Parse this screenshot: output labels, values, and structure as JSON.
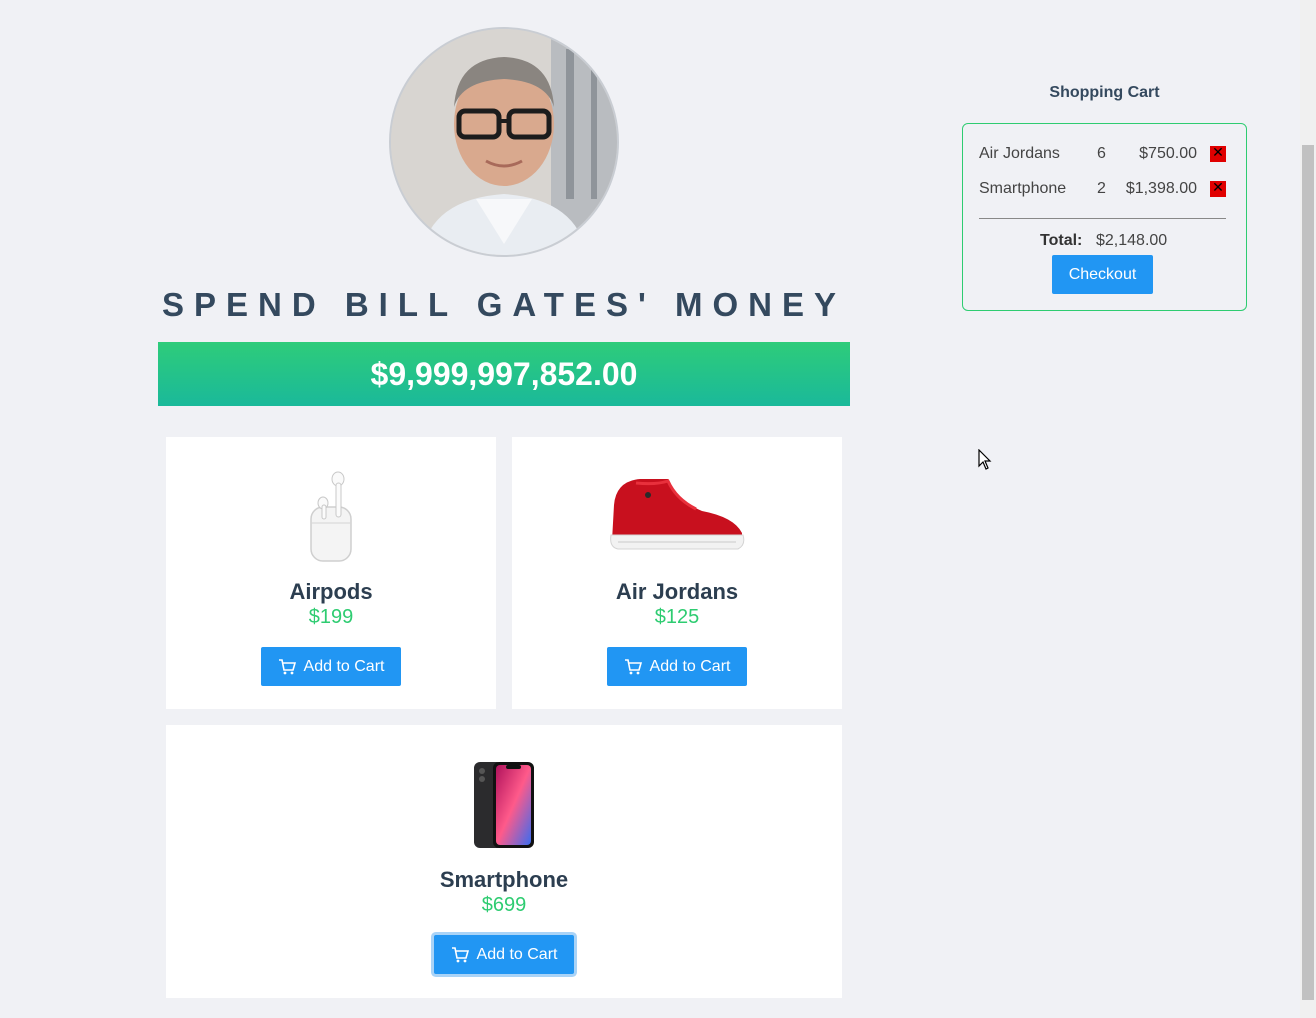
{
  "header": {
    "title": "SPEND BILL GATES' MONEY",
    "balance": "$9,999,997,852.00"
  },
  "products": [
    {
      "name": "Airpods",
      "price": "$199",
      "button": "Add to Cart"
    },
    {
      "name": "Air Jordans",
      "price": "$125",
      "button": "Add to Cart"
    },
    {
      "name": "Smartphone",
      "price": "$699",
      "button": "Add to Cart"
    }
  ],
  "cart": {
    "title": "Shopping Cart",
    "items": [
      {
        "name": "Air Jordans",
        "qty": "6",
        "total": "$750.00"
      },
      {
        "name": "Smartphone",
        "qty": "2",
        "total": "$1,398.00"
      }
    ],
    "total_label": "Total:",
    "total_value": "$2,148.00",
    "checkout_label": "Checkout"
  },
  "colors": {
    "accent": "#2196f3",
    "price": "#2ecc71",
    "balance_bg": "#2ecc7a",
    "remove": "#e00000"
  },
  "icons": [
    "cart-icon",
    "remove-icon",
    "mouse-cursor-icon"
  ]
}
